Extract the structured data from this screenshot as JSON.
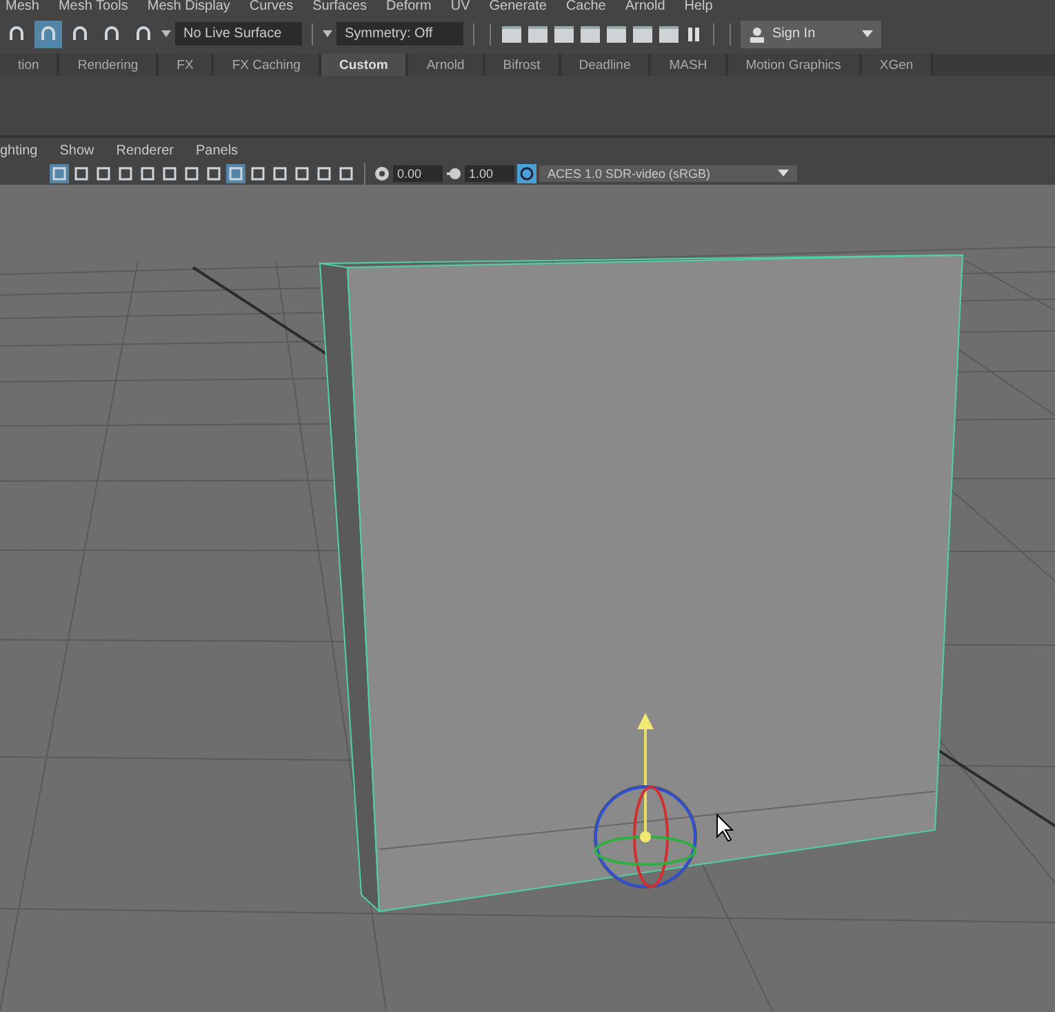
{
  "menu_bar": [
    "Mesh",
    "Mesh Tools",
    "Mesh Display",
    "Curves",
    "Surfaces",
    "Deform",
    "UV",
    "Generate",
    "Cache",
    "Arnold",
    "Help"
  ],
  "status_line": {
    "snap_tools": [
      {
        "selected": false
      },
      {
        "selected": true
      },
      {
        "selected": false
      },
      {
        "selected": false
      },
      {
        "selected": false
      }
    ],
    "live_surface": "No Live Surface",
    "symmetry": "Symmetry: Off",
    "sign_in": "Sign In"
  },
  "shelf_tabs": [
    {
      "label": "tion",
      "selected": false
    },
    {
      "label": "Rendering",
      "selected": false
    },
    {
      "label": "FX",
      "selected": false
    },
    {
      "label": "FX Caching",
      "selected": false
    },
    {
      "label": "Custom",
      "selected": true
    },
    {
      "label": "Arnold",
      "selected": false
    },
    {
      "label": "Bifrost",
      "selected": false
    },
    {
      "label": "Deadline",
      "selected": false
    },
    {
      "label": "MASH",
      "selected": false
    },
    {
      "label": "Motion Graphics",
      "selected": false
    },
    {
      "label": "XGen",
      "selected": false
    }
  ],
  "panel_menu": [
    "ghting",
    "Show",
    "Renderer",
    "Panels"
  ],
  "panel_toolbar": {
    "tools": [
      {
        "selected": true
      },
      {
        "selected": false
      },
      {
        "selected": false
      },
      {
        "selected": false
      },
      {
        "selected": false
      },
      {
        "selected": false
      },
      {
        "selected": false
      },
      {
        "selected": false
      },
      {
        "selected": true
      },
      {
        "selected": false
      },
      {
        "selected": false
      },
      {
        "selected": false
      },
      {
        "selected": false
      },
      {
        "selected": false
      }
    ],
    "exposure": "0.00",
    "gamma": "1.00",
    "color_space": "ACES 1.0 SDR-video (sRGB)"
  }
}
